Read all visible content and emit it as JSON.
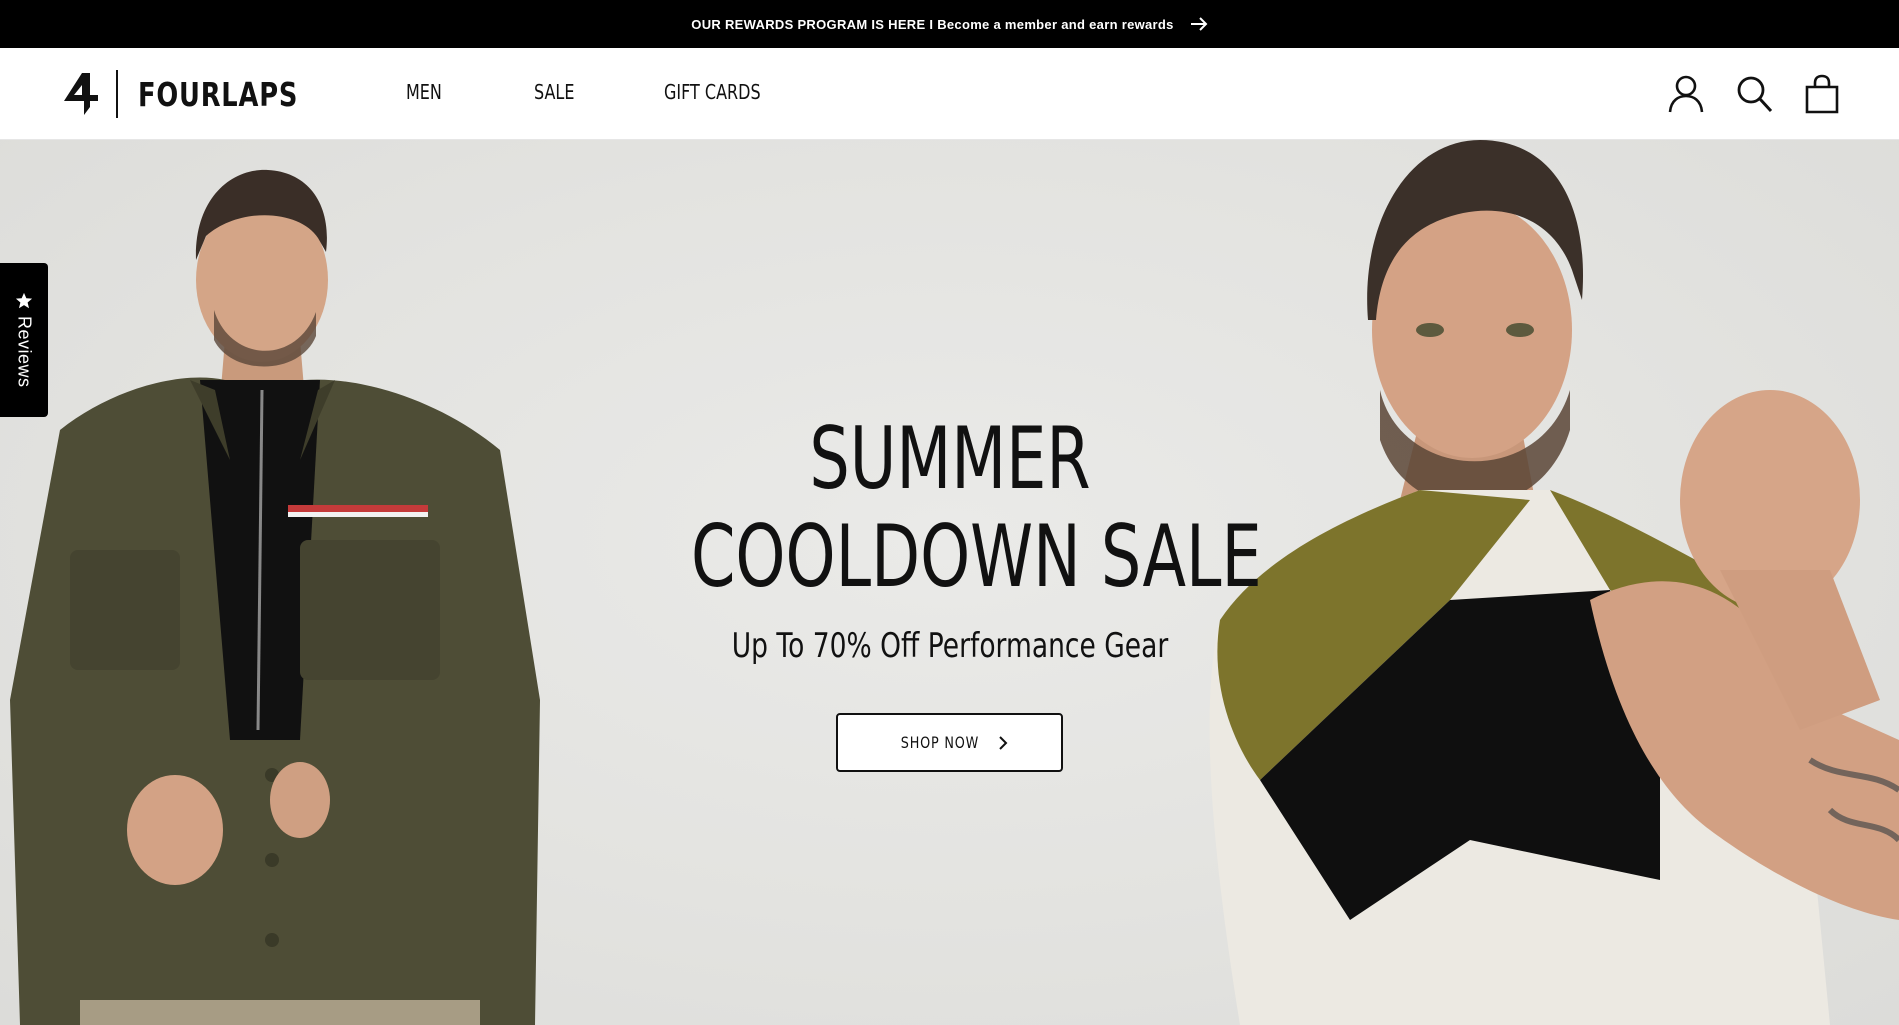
{
  "announcement": {
    "text": "OUR REWARDS PROGRAM IS HERE I Become a member and earn rewards",
    "arrow_icon": "arrow-right-icon"
  },
  "header": {
    "logo_text": "FOURLAPS",
    "nav": [
      {
        "label": "MEN"
      },
      {
        "label": "SALE"
      },
      {
        "label": "GIFT CARDS"
      }
    ],
    "icons": [
      "account-icon",
      "search-icon",
      "cart-icon"
    ]
  },
  "hero": {
    "title_line1": "SUMMER",
    "title_line2": "COOLDOWN SALE",
    "subtitle": "Up To 70% Off Performance Gear",
    "cta_label": "SHOP NOW"
  },
  "reviews_tab": {
    "label": "Reviews",
    "icon": "star-icon"
  },
  "colors": {
    "announcement_bg": "#000000",
    "hero_bg": "#e3e3e0",
    "jacket": "#4e4d36",
    "shirt_olive": "#7d742c"
  }
}
